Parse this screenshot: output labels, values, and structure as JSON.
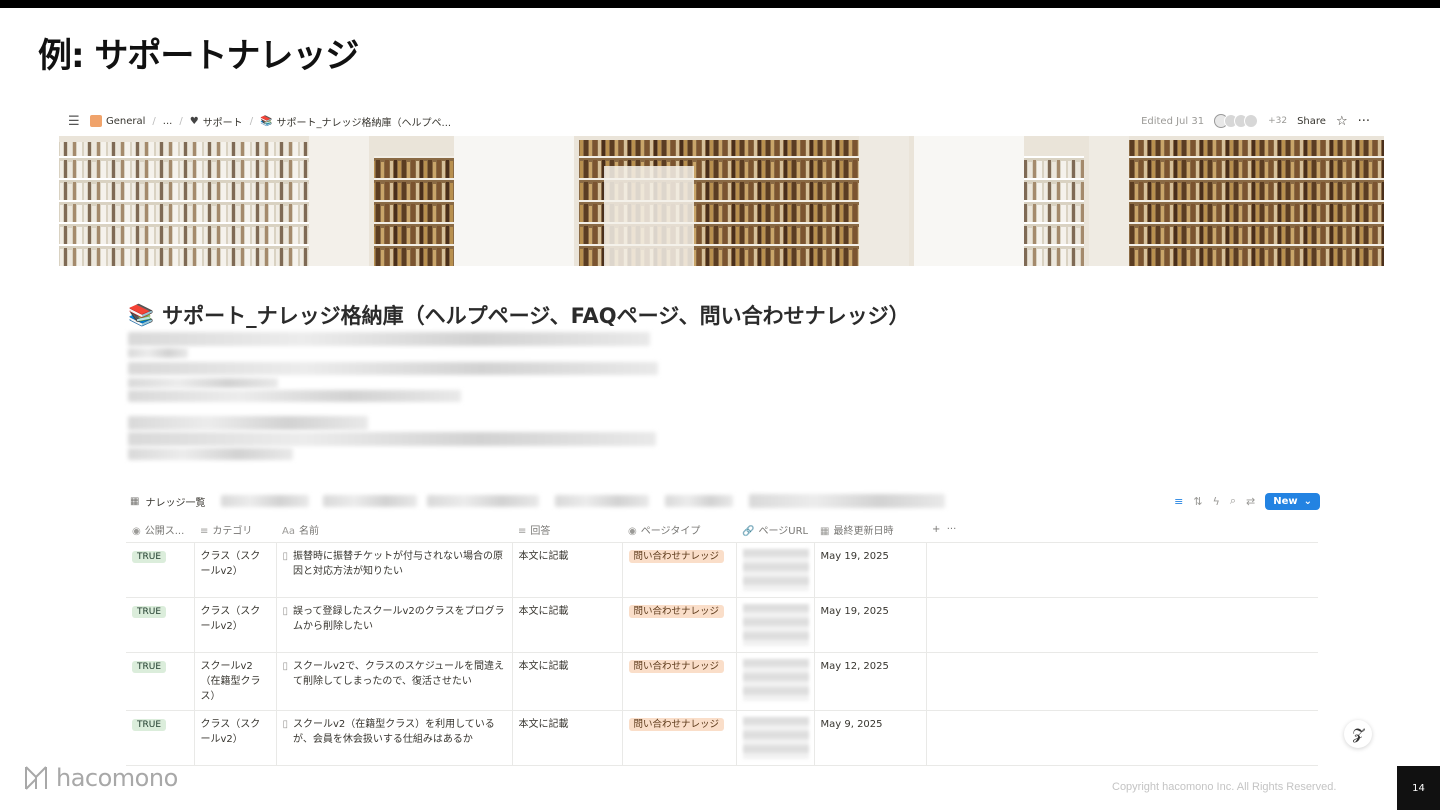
{
  "slide": {
    "title": "例: サポートナレッジ",
    "copyright": "Copyright hacomono Inc. All Rights Reserved.",
    "page_number": "14",
    "logo_text": "hacomono"
  },
  "notion": {
    "breadcrumb": [
      {
        "label": "General",
        "icon": "home-icon"
      },
      {
        "label": "...",
        "icon": ""
      },
      {
        "label": "サポート",
        "icon": "heart-icon"
      },
      {
        "label": "サポート_ナレッジ格納庫（ヘルプペ...",
        "icon": "books-icon"
      }
    ],
    "edited": "Edited Jul 31",
    "avatar_extra": "+32",
    "share_label": "Share",
    "page_title": "サポート_ナレッジ格納庫（ヘルプページ、FAQページ、問い合わせナレッジ）",
    "page_icon": "📚",
    "database": {
      "view_label": "ナレッジ一覧",
      "new_label": "New",
      "columns": [
        "公開ス...",
        "カテゴリ",
        "名前",
        "回答",
        "ページタイプ",
        "ページURL",
        "最終更新日時"
      ],
      "column_icons": [
        "◉",
        "≡",
        "Aa",
        "≡",
        "◉",
        "🔗",
        "▦"
      ],
      "rows": [
        {
          "status": "TRUE",
          "category": "クラス（スクールv2）",
          "name": "振替時に振替チケットが付与されない場合の原因と対応方法が知りたい",
          "answer": "本文に記載",
          "type": "問い合わせナレッジ",
          "updated": "May 19, 2025"
        },
        {
          "status": "TRUE",
          "category": "クラス（スクールv2）",
          "name": "誤って登録したスクールv2のクラスをプログラムから削除したい",
          "answer": "本文に記載",
          "type": "問い合わせナレッジ",
          "updated": "May 19, 2025"
        },
        {
          "status": "TRUE",
          "category": "スクールv2（在籍型クラス）",
          "name": "スクールv2で、クラスのスケジュールを間違えて削除してしまったので、復活させたい",
          "answer": "本文に記載",
          "type": "問い合わせナレッジ",
          "updated": "May 12, 2025"
        },
        {
          "status": "TRUE",
          "category": "クラス（スクールv2）",
          "name": "スクールv2（在籍型クラス）を利用しているが、会員を休会扱いする仕組みはあるか",
          "answer": "本文に記載",
          "type": "問い合わせナレッジ",
          "updated": "May 9, 2025"
        }
      ]
    }
  },
  "colors": {
    "accent_blue": "#2383e2",
    "true_badge": "#dbeddb",
    "type_badge": "#fadec9"
  }
}
